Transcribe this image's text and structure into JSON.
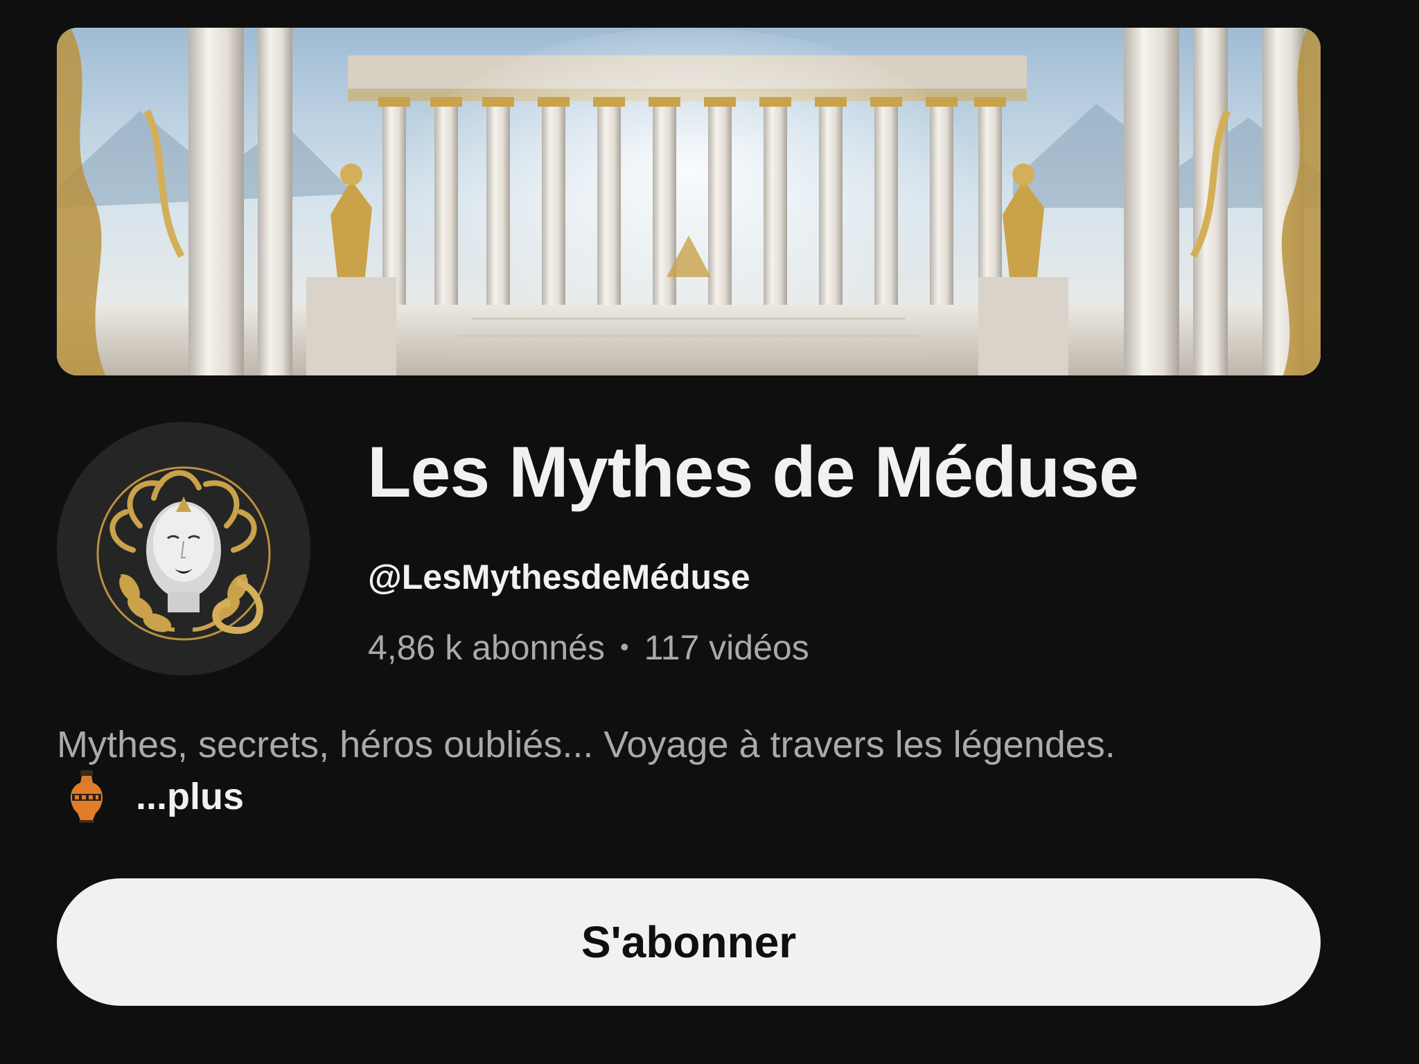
{
  "channel": {
    "name": "Les Mythes de Méduse",
    "handle": "@LesMythesdeMéduse",
    "subscribers": "4,86 k abonnés",
    "separator": "•",
    "videos": "117 vidéos",
    "description": "Mythes, secrets, héros oubliés... Voyage à travers les légendes.",
    "more_label": "...plus"
  },
  "actions": {
    "subscribe_label": "S'abonner"
  },
  "images": {
    "banner": "greek-temple-banner",
    "avatar": "medusa-gold-emblem",
    "description_emoji": "amphora-icon"
  },
  "colors": {
    "background": "#0f0f0f",
    "primary_text": "#f1f1f1",
    "secondary_text": "#aaaaaa",
    "button_bg": "#f1f1f1",
    "button_text": "#0f0f0f",
    "gold": "#c9a24a"
  }
}
